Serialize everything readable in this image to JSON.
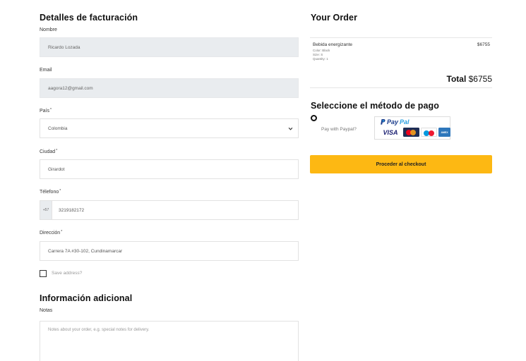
{
  "billing": {
    "title": "Detalles de facturación",
    "nombre_label": "Nombre",
    "nombre_value": "Ricardo Lozada",
    "email_label": "Email",
    "email_value": "aagora12@gmail.com",
    "pais_label": "País",
    "pais_value": "Colombia",
    "ciudad_label": "Ciudad",
    "ciudad_value": "Girardot",
    "telefono_label": "Télefono",
    "telefono_prefix": "+57",
    "telefono_value": "3219182172",
    "direccion_label": "Dirección",
    "direccion_value": "Carrera 7A #30-102, Cundinamarcar",
    "required_mark": "*",
    "save_address_label": "Save address?"
  },
  "additional": {
    "title": "Información adicional",
    "notas_label": "Notas",
    "notas_placeholder": "Notes about your order, e.g. special notes for delivery."
  },
  "order": {
    "title": "Your Order",
    "item": {
      "name": "Bebida energizante",
      "color": "Color: Black",
      "size": "Size: S",
      "quantity": "Quantity: 1",
      "price": "$6755"
    },
    "total_label": "Total",
    "total_value": "$6755"
  },
  "payment": {
    "title": "Seleccione el método de pago",
    "paypal_option_label": "Pay with Paypal?",
    "paypal_logo_text_1": "Pay",
    "paypal_logo_text_2": "Pal",
    "visa_text": "VISA",
    "amex_text": "AMEX",
    "checkout_label": "Proceder al checkout"
  },
  "colors": {
    "accent": "#fdb813",
    "readonly_bg": "#e9ecef",
    "paypal_dark": "#1c3d8c",
    "paypal_light": "#2b9fe0"
  }
}
